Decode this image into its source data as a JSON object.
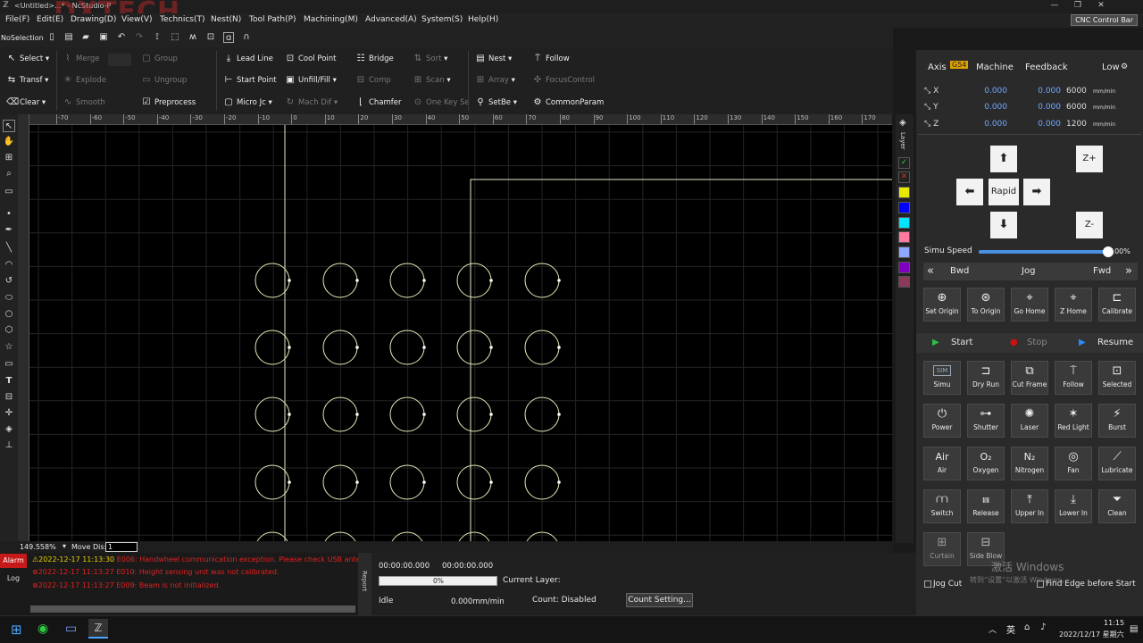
{
  "titlebar": {
    "title": "<Untitled>...* - NcStudio-P",
    "logo_text": "DXTECH"
  },
  "menu": [
    "File(F)",
    "Edit(E)",
    "Drawing(D)",
    "View(V)",
    "Technics(T)",
    "Nest(N)",
    "Tool Path(P)",
    "Machining(M)",
    "Advanced(A)",
    "System(S)",
    "Help(H)"
  ],
  "cnc_control_bar": "CNC Control Bar",
  "quickbar": {
    "selection": "NoSelection"
  },
  "ribbon": {
    "select": "Select",
    "transf": "Transf",
    "clear": "Clear",
    "merge": "Merge",
    "explode": "Explode",
    "smooth": "Smooth",
    "group": "Group",
    "ungroup": "Ungroup",
    "preprocess": "Preprocess",
    "lead_line": "Lead Line",
    "start_point": "Start Point",
    "micro_jt": "Micro Jc",
    "cool_point": "Cool Point",
    "unfill_fill": "Unfill/Fill",
    "mach_dir": "Mach Dif",
    "bridge": "Bridge",
    "comp": "Comp",
    "chamfer": "Chamfer",
    "sort": "Sort",
    "scan": "Scan",
    "one_key_set": "One Key Se",
    "nest": "Nest",
    "array": "Array",
    "set_bevel": "SetBe",
    "follow": "Follow",
    "focus_control": "FocusControl",
    "common_param": "CommonParam"
  },
  "ruler_ticks": [
    "-70",
    "-60",
    "-50",
    "-40",
    "-30",
    "-20",
    "-10",
    "0",
    "10",
    "20",
    "30",
    "40",
    "50",
    "60",
    "70",
    "80",
    "90",
    "100",
    "110",
    "120",
    "130",
    "140",
    "150",
    "160",
    "170"
  ],
  "layer_label": "Layer",
  "layer_colors": [
    "#e8e800",
    "#0000ff",
    "#00e5ff",
    "#ff7aa0",
    "#8fa8ff",
    "#8000c0",
    "#8a3a5a"
  ],
  "status": {
    "zoom": "149.558%",
    "move_dis_label": "Move Dis:",
    "move_dis_value": "1"
  },
  "log": {
    "alarm_tab": "Alarm",
    "log_tab": "Log",
    "entries": [
      {
        "time": "2022-12-17 11:13:30",
        "msg": "E006: Handwheel communication exception. Please check USB anten"
      },
      {
        "time": "2022-12-17 11:13:27",
        "msg": "E010: Height sensing unit was not calibrated."
      },
      {
        "time": "2022-12-17 11:13:27",
        "msg": "E009: Beam is not initialized."
      }
    ]
  },
  "report_label": "Report",
  "info": {
    "time1": "00:00:00.000",
    "time2": "00:00:00.000",
    "progress": "0%",
    "progress_value": 0,
    "current_layer": "Current Layer:",
    "state": "Idle",
    "speed": "0.000mm/min",
    "count": "Count: Disabled",
    "count_setting": "Count Setting..."
  },
  "axis_panel": {
    "axis": "Axis",
    "g54": "G54",
    "machine": "Machine",
    "feedback": "Feedback",
    "speed_mode": "Low",
    "rows": [
      {
        "name": "X",
        "v1": "0.000",
        "v2": "0.000",
        "feed": "6000",
        "unit": "mm/min"
      },
      {
        "name": "Y",
        "v1": "0.000",
        "v2": "0.000",
        "feed": "6000",
        "unit": "mm/min"
      },
      {
        "name": "Z",
        "v1": "0.000",
        "v2": "0.000",
        "feed": "1200",
        "unit": "mm/min"
      }
    ]
  },
  "jog": {
    "zplus": "Z+",
    "zminus": "Z-",
    "rapid": "Rapid"
  },
  "simu_speed": {
    "label": "Simu Speed",
    "value": "100%",
    "level": 1.0
  },
  "bwd_jog_fwd": {
    "bwd": "Bwd",
    "jog": "Jog",
    "fwd": "Fwd"
  },
  "origin_buttons": [
    "Set Origin",
    "To Origin",
    "Go Home",
    "Z Home",
    "Calibrate"
  ],
  "run": {
    "start": "Start",
    "stop": "Stop",
    "resume": "Resume"
  },
  "func_buttons": [
    [
      "Simu",
      "Dry Run",
      "Cut Frame",
      "Follow",
      "Selected"
    ],
    [
      "Power",
      "Shutter",
      "Laser",
      "Red Light",
      "Burst"
    ],
    [
      "Air",
      "Oxygen",
      "Nitrogen",
      "Fan",
      "Lubricate"
    ],
    [
      "Switch",
      "Release",
      "Upper In",
      "Lower In",
      "Clean"
    ],
    [
      "Curtain",
      "Side Blow"
    ]
  ],
  "func_icon_text": {
    "air": "Air",
    "oxygen": "O₂",
    "nitrogen": "N₂",
    "simu": "SIM"
  },
  "bottom_checks": {
    "jog_cut": "Jog Cut",
    "find_edge": "Find Edge before Start"
  },
  "watermark": {
    "line1": "激活 Windows",
    "line2": "转到“设置”以激活 Windows。"
  },
  "taskbar": {
    "time": "11:15",
    "date": "2022/12/17 星期六",
    "ime": "英"
  }
}
